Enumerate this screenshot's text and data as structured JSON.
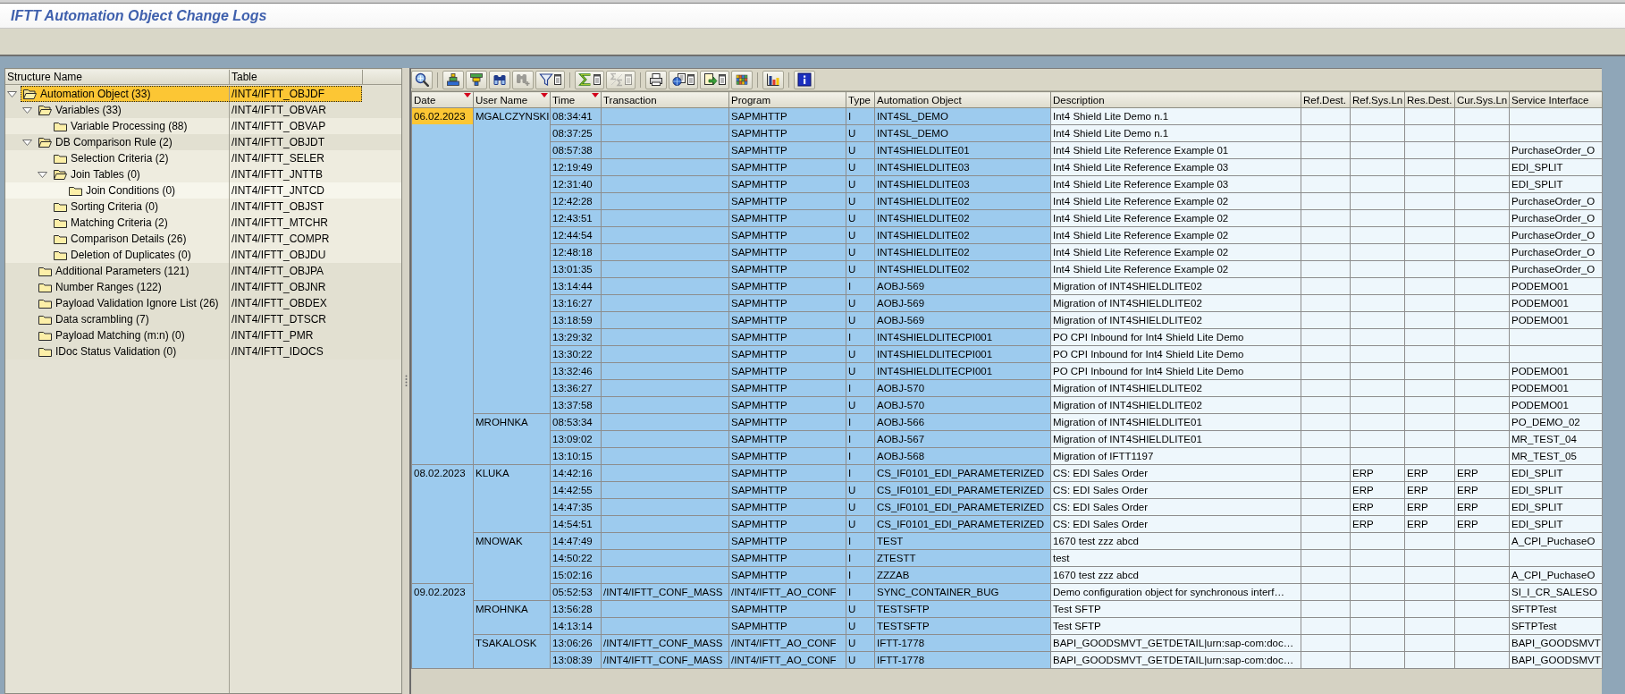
{
  "window": {
    "title": "IFTT Automation Object Change Logs"
  },
  "tree": {
    "columns": [
      "Structure Name",
      "Table"
    ],
    "items": [
      {
        "label": "Automation Object (33)",
        "table": "/INT4/IFTT_OBJDF",
        "selected": true,
        "expanded": true,
        "children": [
          {
            "label": "Variables (33)",
            "table": "/INT4/IFTT_OBVAR",
            "selected": false,
            "expanded": true,
            "children": [
              {
                "label": "Variable Processing (88)",
                "table": "/INT4/IFTT_OBVAP",
                "selected": false
              }
            ]
          },
          {
            "label": "DB Comparison Rule (2)",
            "table": "/INT4/IFTT_OBJDT",
            "selected": false,
            "expanded": true,
            "children": [
              {
                "label": "Selection Criteria (2)",
                "table": "/INT4/IFTT_SELER",
                "selected": false
              },
              {
                "label": "Join Tables (0)",
                "table": "/INT4/IFTT_JNTTB",
                "selected": false,
                "expanded": true,
                "children": [
                  {
                    "label": "Join Conditions (0)",
                    "table": "/INT4/IFTT_JNTCD",
                    "selected": false
                  }
                ]
              },
              {
                "label": "Sorting Criteria (0)",
                "table": "/INT4/IFTT_OBJST",
                "selected": false
              },
              {
                "label": "Matching Criteria (2)",
                "table": "/INT4/IFTT_MTCHR",
                "selected": false
              },
              {
                "label": "Comparison Details (26)",
                "table": "/INT4/IFTT_COMPR",
                "selected": false
              },
              {
                "label": "Deletion of Duplicates (0)",
                "table": "/INT4/IFTT_OBJDU",
                "selected": false
              }
            ]
          },
          {
            "label": "Additional Parameters (121)",
            "table": "/INT4/IFTT_OBJPA",
            "selected": false
          },
          {
            "label": "Number Ranges (122)",
            "table": "/INT4/IFTT_OBJNR",
            "selected": false
          },
          {
            "label": "Payload Validation Ignore List (26)",
            "table": "/INT4/IFTT_OBDEX",
            "selected": false
          },
          {
            "label": "Data scrambling (7)",
            "table": "/INT4/IFTT_DTSCR",
            "selected": false
          },
          {
            "label": "Payload Matching (m:n) (0)",
            "table": "/INT4/IFTT_PMR",
            "selected": false
          },
          {
            "label": "IDoc Status Validation (0)",
            "table": "/INT4/IFTT_IDOCS",
            "selected": false
          }
        ]
      }
    ]
  },
  "toolbar": {
    "groups": [
      [
        {
          "kind": "details",
          "disabled": false,
          "menu": false
        }
      ],
      [
        {
          "kind": "ascending",
          "disabled": false,
          "menu": false
        },
        {
          "kind": "descending",
          "disabled": false,
          "menu": false
        },
        {
          "kind": "find",
          "disabled": false,
          "menu": false
        },
        {
          "kind": "findnext",
          "disabled": true,
          "menu": false
        },
        {
          "kind": "filter",
          "disabled": false,
          "menu": true
        }
      ],
      [
        {
          "kind": "sum",
          "disabled": false,
          "menu": true
        },
        {
          "kind": "subtotal",
          "disabled": true,
          "menu": true
        }
      ],
      [
        {
          "kind": "print",
          "disabled": false,
          "menu": false
        },
        {
          "kind": "views",
          "disabled": false,
          "menu": true
        },
        {
          "kind": "export",
          "disabled": false,
          "menu": true
        },
        {
          "kind": "layout",
          "disabled": false,
          "menu": false
        }
      ],
      [
        {
          "kind": "graphic",
          "disabled": false,
          "menu": false
        }
      ],
      [
        {
          "kind": "info",
          "disabled": false,
          "menu": false
        }
      ]
    ]
  },
  "table": {
    "columns": [
      {
        "label": "Date",
        "key": true,
        "sorted": true
      },
      {
        "label": "User Name",
        "key": true,
        "sorted": true
      },
      {
        "label": "Time",
        "key": true,
        "sorted": true
      },
      {
        "label": "Transaction",
        "key": true,
        "sorted": false
      },
      {
        "label": "Program",
        "key": true,
        "sorted": false
      },
      {
        "label": "Type",
        "key": true,
        "sorted": false
      },
      {
        "label": "Automation Object",
        "key": true,
        "sorted": false
      },
      {
        "label": "Description",
        "key": false,
        "sorted": false
      },
      {
        "label": "Ref.Dest.",
        "key": false,
        "sorted": false
      },
      {
        "label": "Ref.Sys.Ln",
        "key": false,
        "sorted": false
      },
      {
        "label": "Res.Dest.",
        "key": false,
        "sorted": false
      },
      {
        "label": "Cur.Sys.Ln",
        "key": false,
        "sorted": false
      },
      {
        "label": "Service Interface",
        "key": false,
        "sorted": false
      }
    ],
    "rows": [
      {
        "date": {
          "text": "06.02.2023",
          "selected": true
        },
        "user_name": "MGALCZYNSKI",
        "time": "08:34:41",
        "program": "SAPMHTTP",
        "type": "I",
        "automation_object": "INT4SL_DEMO",
        "description": "Int4 Shield Lite Demo n.1"
      },
      {
        "time": "08:37:25",
        "program": "SAPMHTTP",
        "type": "U",
        "automation_object": "INT4SL_DEMO",
        "description": "Int4 Shield Lite Demo n.1"
      },
      {
        "time": "08:57:38",
        "program": "SAPMHTTP",
        "type": "U",
        "automation_object": "INT4SHIELDLITE01",
        "description": "Int4 Shield Lite Reference Example 01",
        "service_interface": "PurchaseOrder_O"
      },
      {
        "time": "12:19:49",
        "program": "SAPMHTTP",
        "type": "U",
        "automation_object": "INT4SHIELDLITE03",
        "description": "Int4 Shield Lite Reference Example 03",
        "service_interface": "EDI_SPLIT"
      },
      {
        "time": "12:31:40",
        "program": "SAPMHTTP",
        "type": "U",
        "automation_object": "INT4SHIELDLITE03",
        "description": "Int4 Shield Lite Reference Example 03",
        "service_interface": "EDI_SPLIT"
      },
      {
        "time": "12:42:28",
        "program": "SAPMHTTP",
        "type": "U",
        "automation_object": "INT4SHIELDLITE02",
        "description": "Int4 Shield Lite Reference Example 02",
        "service_interface": "PurchaseOrder_O"
      },
      {
        "time": "12:43:51",
        "program": "SAPMHTTP",
        "type": "U",
        "automation_object": "INT4SHIELDLITE02",
        "description": "Int4 Shield Lite Reference Example 02",
        "service_interface": "PurchaseOrder_O"
      },
      {
        "time": "12:44:54",
        "program": "SAPMHTTP",
        "type": "U",
        "automation_object": "INT4SHIELDLITE02",
        "description": "Int4 Shield Lite Reference Example 02",
        "service_interface": "PurchaseOrder_O"
      },
      {
        "time": "12:48:18",
        "program": "SAPMHTTP",
        "type": "U",
        "automation_object": "INT4SHIELDLITE02",
        "description": "Int4 Shield Lite Reference Example 02",
        "service_interface": "PurchaseOrder_O"
      },
      {
        "time": "13:01:35",
        "program": "SAPMHTTP",
        "type": "U",
        "automation_object": "INT4SHIELDLITE02",
        "description": "Int4 Shield Lite Reference Example 02",
        "service_interface": "PurchaseOrder_O"
      },
      {
        "time": "13:14:44",
        "program": "SAPMHTTP",
        "type": "I",
        "automation_object": "AOBJ-569",
        "description": "Migration of INT4SHIELDLITE02",
        "service_interface": "PODEMO01"
      },
      {
        "time": "13:16:27",
        "program": "SAPMHTTP",
        "type": "U",
        "automation_object": "AOBJ-569",
        "description": "Migration of INT4SHIELDLITE02",
        "service_interface": "PODEMO01"
      },
      {
        "time": "13:18:59",
        "program": "SAPMHTTP",
        "type": "U",
        "automation_object": "AOBJ-569",
        "description": "Migration of INT4SHIELDLITE02",
        "service_interface": "PODEMO01"
      },
      {
        "time": "13:29:32",
        "program": "SAPMHTTP",
        "type": "I",
        "automation_object": "INT4SHIELDLITECPI001",
        "description": "PO CPI Inbound for Int4 Shield Lite Demo"
      },
      {
        "time": "13:30:22",
        "program": "SAPMHTTP",
        "type": "U",
        "automation_object": "INT4SHIELDLITECPI001",
        "description": "PO CPI Inbound for Int4 Shield Lite Demo"
      },
      {
        "time": "13:32:46",
        "program": "SAPMHTTP",
        "type": "U",
        "automation_object": "INT4SHIELDLITECPI001",
        "description": "PO CPI Inbound for Int4 Shield Lite Demo",
        "service_interface": "PODEMO01"
      },
      {
        "time": "13:36:27",
        "program": "SAPMHTTP",
        "type": "I",
        "automation_object": "AOBJ-570",
        "description": "Migration of INT4SHIELDLITE02",
        "service_interface": "PODEMO01"
      },
      {
        "time": "13:37:58",
        "program": "SAPMHTTP",
        "type": "U",
        "automation_object": "AOBJ-570",
        "description": "Migration of INT4SHIELDLITE02",
        "service_interface": "PODEMO01"
      },
      {
        "user_name": "MROHNKA",
        "time": "08:53:34",
        "program": "SAPMHTTP",
        "type": "I",
        "automation_object": "AOBJ-566",
        "description": "Migration of INT4SHIELDLITE01",
        "service_interface": "PO_DEMO_02"
      },
      {
        "time": "13:09:02",
        "program": "SAPMHTTP",
        "type": "I",
        "automation_object": "AOBJ-567",
        "description": "Migration of INT4SHIELDLITE01",
        "service_interface": "MR_TEST_04"
      },
      {
        "time": "13:10:15",
        "program": "SAPMHTTP",
        "type": "I",
        "automation_object": "AOBJ-568",
        "description": "Migration of IFTT1197",
        "service_interface": "MR_TEST_05"
      },
      {
        "date": {
          "text": "08.02.2023",
          "selected": false
        },
        "user_name": "KLUKA",
        "time": "14:42:16",
        "program": "SAPMHTTP",
        "type": "I",
        "automation_object": "CS_IF0101_EDI_PARAMETERIZED",
        "description": "CS: EDI Sales Order",
        "ref_sys_ln": "ERP",
        "res_dest": "ERP",
        "cur_sys_ln": "ERP",
        "service_interface": "EDI_SPLIT"
      },
      {
        "time": "14:42:55",
        "program": "SAPMHTTP",
        "type": "U",
        "automation_object": "CS_IF0101_EDI_PARAMETERIZED",
        "description": "CS: EDI Sales Order",
        "ref_sys_ln": "ERP",
        "res_dest": "ERP",
        "cur_sys_ln": "ERP",
        "service_interface": "EDI_SPLIT"
      },
      {
        "time": "14:47:35",
        "program": "SAPMHTTP",
        "type": "U",
        "automation_object": "CS_IF0101_EDI_PARAMETERIZED",
        "description": "CS: EDI Sales Order",
        "ref_sys_ln": "ERP",
        "res_dest": "ERP",
        "cur_sys_ln": "ERP",
        "service_interface": "EDI_SPLIT"
      },
      {
        "time": "14:54:51",
        "program": "SAPMHTTP",
        "type": "U",
        "automation_object": "CS_IF0101_EDI_PARAMETERIZED",
        "description": "CS: EDI Sales Order",
        "ref_sys_ln": "ERP",
        "res_dest": "ERP",
        "cur_sys_ln": "ERP",
        "service_interface": "EDI_SPLIT"
      },
      {
        "user_name": "MNOWAK",
        "time": "14:47:49",
        "program": "SAPMHTTP",
        "type": "I",
        "automation_object": "TEST",
        "description": "1670 test zzz abcd",
        "service_interface": "A_CPI_PuchaseO"
      },
      {
        "time": "14:50:22",
        "program": "SAPMHTTP",
        "type": "I",
        "automation_object": "ZTESTT",
        "description": "test"
      },
      {
        "time": "15:02:16",
        "program": "SAPMHTTP",
        "type": "I",
        "automation_object": "ZZZAB",
        "description": "1670 test zzz abcd",
        "service_interface": "A_CPI_PuchaseO"
      },
      {
        "date": {
          "text": "09.02.2023",
          "selected": false
        },
        "time": "05:52:53",
        "transaction": "/INT4/IFTT_CONF_MASS",
        "program": "/INT4/IFTT_AO_CONF",
        "type": "I",
        "automation_object": "SYNC_CONTAINER_BUG",
        "description": "Demo configuration object for synchronous interf…",
        "service_interface": "SI_I_CR_SALESO"
      },
      {
        "user_name": "MROHNKA",
        "time": "13:56:28",
        "program": "SAPMHTTP",
        "type": "U",
        "automation_object": "TESTSFTP",
        "description": "Test SFTP",
        "service_interface": "SFTPTest"
      },
      {
        "time": "14:13:14",
        "program": "SAPMHTTP",
        "type": "U",
        "automation_object": "TESTSFTP",
        "description": "Test SFTP",
        "service_interface": "SFTPTest"
      },
      {
        "user_name": "TSAKALOSK",
        "time": "13:06:26",
        "transaction": "/INT4/IFTT_CONF_MASS",
        "program": "/INT4/IFTT_AO_CONF",
        "type": "U",
        "automation_object": "IFTT-1778",
        "description": "BAPI_GOODSMVT_GETDETAIL|urn:sap-com:doc…",
        "service_interface": "BAPI_GOODSMVT"
      },
      {
        "time": "13:08:39",
        "transaction": "/INT4/IFTT_CONF_MASS",
        "program": "/INT4/IFTT_AO_CONF",
        "type": "U",
        "automation_object": "IFTT-1778",
        "description": "BAPI_GOODSMVT_GETDETAIL|urn:sap-com:doc…",
        "service_interface": "BAPI_GOODSMVT"
      }
    ]
  }
}
